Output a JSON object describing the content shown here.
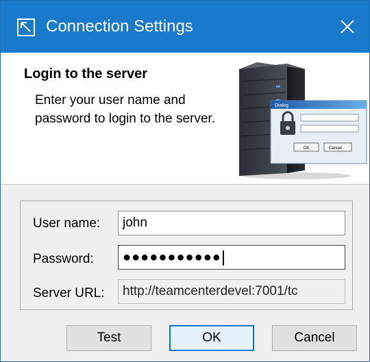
{
  "window": {
    "title": "Connection Settings"
  },
  "header": {
    "heading": "Login to the server",
    "description": "Enter your user name and password to login to the server.",
    "art_dialog_title": "Dialog",
    "art_ok": "OK",
    "art_cancel": "Cancel"
  },
  "form": {
    "username_label": "User name:",
    "username_value": "john",
    "password_label": "Password:",
    "password_mask": "●●●●●●●●●●●",
    "server_url_label": "Server URL:",
    "server_url_value": "http://teamcenterdevel:7001/tc"
  },
  "buttons": {
    "test": "Test",
    "ok": "OK",
    "cancel": "Cancel"
  },
  "colors": {
    "titlebar": "#1979ca",
    "accent": "#0078d7"
  },
  "icons": {
    "app": "dialog-arrow-icon",
    "close": "close-icon",
    "illustration": "server-login-illustration"
  }
}
